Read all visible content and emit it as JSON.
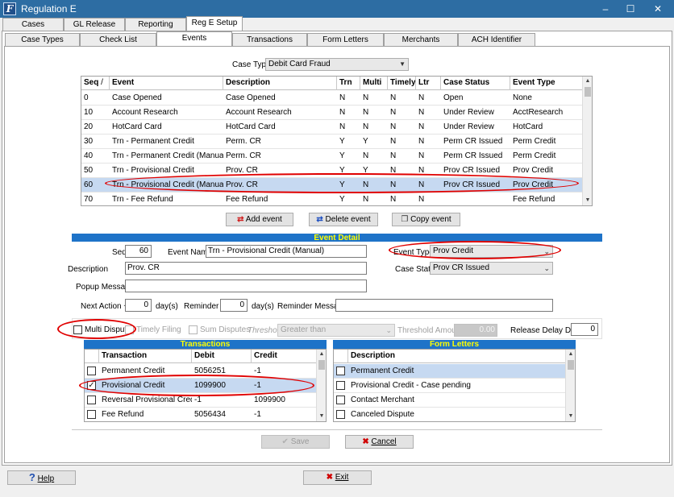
{
  "window": {
    "title": "Regulation E",
    "minimize": "–",
    "maximize": "☐",
    "close": "✕"
  },
  "top_tabs": [
    "Cases",
    "GL Release",
    "Reporting",
    "Reg E Setup"
  ],
  "sub_tabs": [
    "Case Types",
    "Check List",
    "Events",
    "Transactions",
    "Form Letters",
    "Merchants",
    "ACH Identifier"
  ],
  "case_type": {
    "label": "Case Type",
    "value": "Debit Card Fraud"
  },
  "events_grid": {
    "headers": [
      "Seq",
      "Event",
      "Description",
      "Trn",
      "Multi",
      "Timely",
      "Ltr",
      "Case Status",
      "Event Type"
    ],
    "sort_indicator": "/",
    "rows": [
      [
        "0",
        "Case Opened",
        "Case Opened",
        "N",
        "N",
        "N",
        "N",
        "Open",
        "None"
      ],
      [
        "10",
        "Account Research",
        "Account Research",
        "N",
        "N",
        "N",
        "N",
        "Under Review",
        "AcctResearch"
      ],
      [
        "20",
        "HotCard Card",
        "HotCard Card",
        "N",
        "N",
        "N",
        "N",
        "Under Review",
        "HotCard"
      ],
      [
        "30",
        "Trn - Permanent Credit",
        "Perm. CR",
        "Y",
        "Y",
        "N",
        "N",
        "Perm CR Issued",
        "Perm Credit"
      ],
      [
        "40",
        "Trn - Permanent Credit (Manual)",
        "Perm. CR",
        "Y",
        "N",
        "N",
        "N",
        "Perm CR Issued",
        "Perm Credit"
      ],
      [
        "50",
        "Trn - Provisional Credit",
        "Prov. CR",
        "Y",
        "Y",
        "N",
        "N",
        "Prov CR Issued",
        "Prov Credit"
      ],
      [
        "60",
        "Trn - Provisional Credit (Manual)",
        "Prov. CR",
        "Y",
        "N",
        "N",
        "N",
        "Prov CR Issued",
        "Prov Credit"
      ],
      [
        "70",
        "Trn - Fee Refund",
        "Fee Refund",
        "Y",
        "N",
        "N",
        "N",
        "",
        "Fee Refund"
      ]
    ]
  },
  "event_buttons": {
    "add": "Add event",
    "delete": "Delete event",
    "copy": "Copy event"
  },
  "event_detail": {
    "title": "Event Detail",
    "seq_label": "Seq",
    "seq": "60",
    "event_name_label": "Event Name",
    "event_name": "Trn - Provisional Credit (Manual)",
    "event_type_label": "Event Type",
    "event_type": "Prov Credit",
    "description_label": "Description",
    "description": "Prov. CR",
    "case_state_label": "Case State",
    "case_state": "Prov CR Issued",
    "popup_label": "Popup Message",
    "popup": "",
    "next_action_label": "Next Action +",
    "next_action": "0",
    "days1": "day(s)",
    "reminder_label": "Reminder +",
    "reminder": "0",
    "days2": "day(s)",
    "reminder_msg_label": "Reminder Message",
    "reminder_msg": "",
    "multi_dispute": "Multi Dispute",
    "timely_filing": "Timely Filing",
    "sum_disputes": "Sum Disputes",
    "threshold_label": "Threshold",
    "threshold": "Greater than",
    "threshold_amount_label": "Threshold Amount",
    "threshold_amount": "0.00",
    "release_delay_label": "Release Delay Days",
    "release_delay": "0"
  },
  "transactions": {
    "title": "Transactions",
    "headers": [
      "Transaction",
      "Debit",
      "Credit"
    ],
    "rows": [
      {
        "checked": false,
        "cells": [
          "Permanent Credit",
          "5056251",
          "-1"
        ]
      },
      {
        "checked": true,
        "cells": [
          "Provisional Credit",
          "1099900",
          "-1"
        ]
      },
      {
        "checked": false,
        "cells": [
          "Reversal Provisional Credit",
          "-1",
          "1099900"
        ]
      },
      {
        "checked": false,
        "cells": [
          "Fee Refund",
          "5056434",
          "-1"
        ]
      }
    ]
  },
  "form_letters": {
    "title": "Form Letters",
    "headers": [
      "Description"
    ],
    "rows": [
      "Permanent Credit",
      "Provisional Credit - Case pending",
      "Contact Merchant",
      "Canceled Dispute"
    ]
  },
  "actions": {
    "save": "Save",
    "cancel": "Cancel"
  },
  "footer": {
    "help": "Help",
    "exit": "Exit"
  },
  "check_mark": "✓",
  "colors": {
    "titlebar": "#2d6da3",
    "section_bar": "#1e73c8",
    "section_text": "#ffff00",
    "selected_row": "#c6d9f1",
    "annotation": "#e00000"
  }
}
